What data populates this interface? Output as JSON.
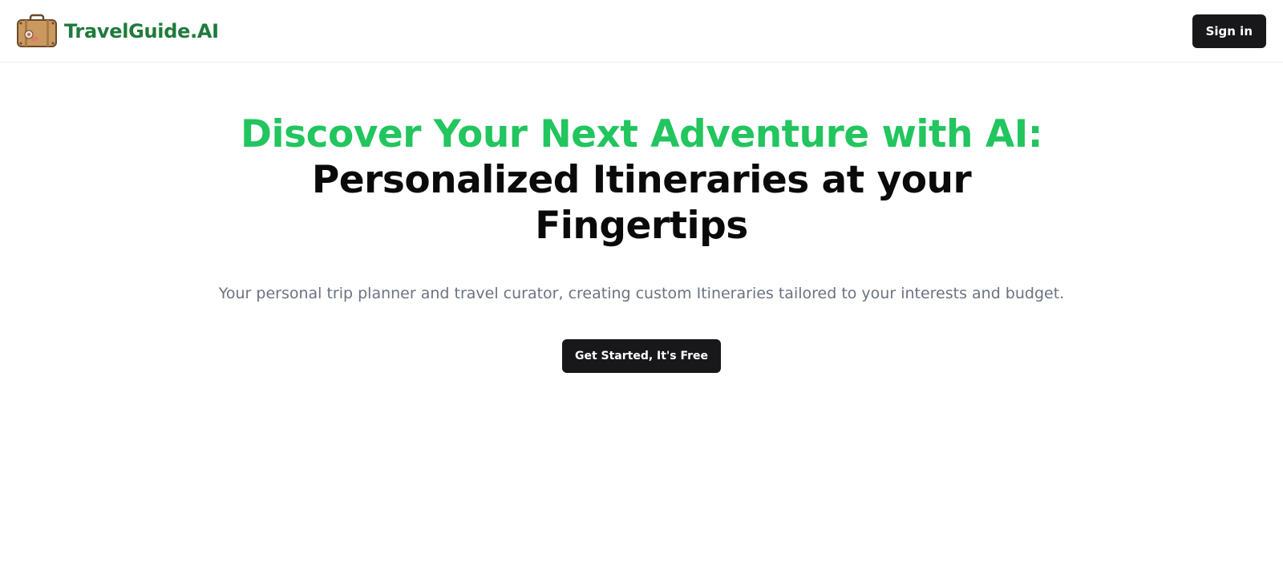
{
  "header": {
    "brand_name": "TravelGuide.AI",
    "logo_icon": "suitcase-icon",
    "signin_label": "Sign in"
  },
  "hero": {
    "headline_accent": "Discover Your Next Adventure with AI:",
    "headline_main": "Personalized Itineraries at your Fingertips",
    "subtitle": "Your personal trip planner and travel curator, creating custom Itineraries tailored to your interests and budget.",
    "cta_label": "Get Started, It's Free"
  },
  "colors": {
    "brand_green": "#1f7a3c",
    "accent_green": "#22c55e",
    "button_dark": "#18181b",
    "subtitle_gray": "#6b7280"
  }
}
